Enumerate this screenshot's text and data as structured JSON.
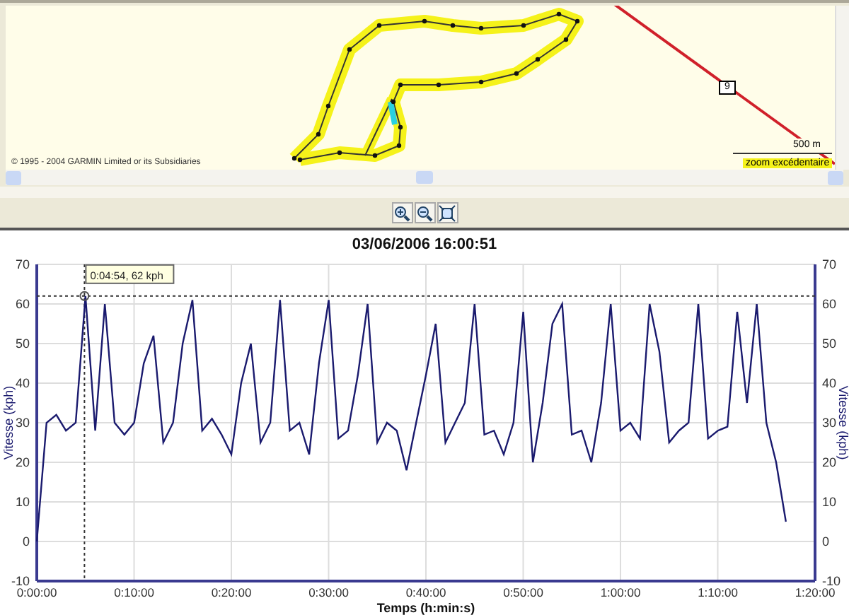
{
  "map": {
    "copyright": "© 1995 - 2004 GARMIN Limited or its Subsidiaries",
    "road_number": "9",
    "scale_label": "500 m",
    "zoom_notice": "zoom excédentaire"
  },
  "chart": {
    "title": "03/06/2006 16:00:51",
    "right_axis_label": "Vitesse (kph)",
    "chart_data": {
      "type": "line",
      "xlabel": "Temps (h:min:s)",
      "ylabel": "Vitesse (kph)",
      "xlim": [
        0,
        80
      ],
      "ylim": [
        -10,
        70
      ],
      "xticks": [
        {
          "value": 0,
          "label": "0:00:00"
        },
        {
          "value": 10,
          "label": "0:10:00"
        },
        {
          "value": 20,
          "label": "0:20:00"
        },
        {
          "value": 30,
          "label": "0:30:00"
        },
        {
          "value": 40,
          "label": "0:40:00"
        },
        {
          "value": 50,
          "label": "0:50:00"
        },
        {
          "value": 60,
          "label": "1:00:00"
        },
        {
          "value": 70,
          "label": "1:10:00"
        },
        {
          "value": 80,
          "label": "1:20:00"
        }
      ],
      "yticks": [
        -10,
        0,
        10,
        20,
        30,
        40,
        50,
        60,
        70
      ],
      "y2lim": [
        -10,
        70
      ],
      "y2ticks": [
        -10,
        0,
        10,
        20,
        30,
        40,
        50,
        60,
        70
      ],
      "grid": true,
      "ref_lines": [
        {
          "axis": "y",
          "value": 62
        },
        {
          "axis": "x",
          "value": 4.9
        }
      ],
      "x": [
        0,
        1,
        2,
        3,
        4,
        5,
        6,
        7,
        8,
        9,
        10,
        11,
        12,
        13,
        14,
        15,
        16,
        17,
        18,
        19,
        20,
        21,
        22,
        23,
        24,
        25,
        26,
        27,
        28,
        29,
        30,
        31,
        32,
        33,
        34,
        35,
        36,
        37,
        38,
        39,
        40,
        41,
        42,
        43,
        44,
        45,
        46,
        47,
        48,
        49,
        50,
        51,
        52,
        53,
        54,
        55,
        56,
        57,
        58,
        59,
        60,
        61,
        62,
        63,
        64,
        65,
        66,
        67,
        68,
        69,
        70,
        71,
        72,
        73,
        74,
        75,
        76,
        77
      ],
      "series": [
        {
          "color": "#1a1a6e",
          "values": [
            0,
            30,
            32,
            28,
            30,
            62,
            28,
            60,
            30,
            27,
            30,
            45,
            52,
            25,
            30,
            50,
            61,
            28,
            31,
            27,
            22,
            40,
            50,
            25,
            30,
            61,
            28,
            30,
            22,
            45,
            61,
            26,
            28,
            42,
            60,
            25,
            30,
            28,
            18,
            30,
            42,
            55,
            25,
            30,
            35,
            60,
            27,
            28,
            22,
            30,
            58,
            20,
            35,
            55,
            60,
            27,
            28,
            20,
            35,
            60,
            28,
            30,
            26,
            60,
            48,
            25,
            28,
            30,
            60,
            26,
            28,
            29,
            58,
            35,
            60,
            30,
            20,
            5
          ]
        }
      ],
      "annotations": [
        {
          "x": 4.9,
          "y": 62,
          "text": "0:04:54, 62 kph"
        }
      ]
    }
  }
}
